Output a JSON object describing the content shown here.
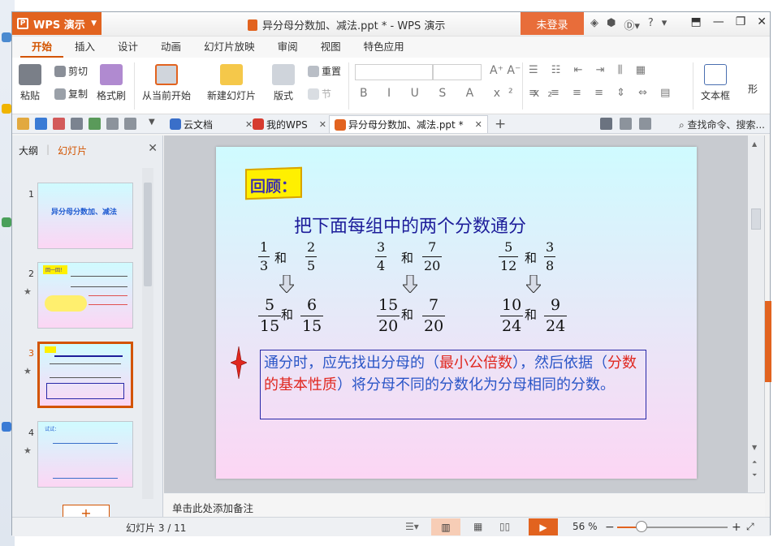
{
  "app": {
    "name": "WPS 演示",
    "doc_title": "异分母分数加、减法.ppt * - WPS 演示",
    "login": "未登录",
    "help": "?"
  },
  "ribbon_tabs": [
    "开始",
    "插入",
    "设计",
    "动画",
    "幻灯片放映",
    "审阅",
    "视图",
    "特色应用"
  ],
  "ribbon": {
    "paste": "粘贴",
    "cut": "剪切",
    "copy": "复制",
    "format_painter": "格式刷",
    "from_current": "从当前开始",
    "new_slide": "新建幻灯片",
    "layout": "版式",
    "reset": "重置",
    "section": "节",
    "textbox": "文本框",
    "shape": "形"
  },
  "doc_tabs": [
    {
      "label": "云文档"
    },
    {
      "label": "我的WPS"
    },
    {
      "label": "异分母分数加、减法.ppt *"
    }
  ],
  "search_command": "查找命令、搜索...",
  "left_panel": {
    "tab_outline": "大纲",
    "tab_slides": "幻灯片",
    "slides": [
      {
        "num": "1",
        "title": "异分母分数加、减法"
      },
      {
        "num": "2",
        "badge": "回一回！"
      },
      {
        "num": "3"
      },
      {
        "num": "4",
        "badge": "试试："
      }
    ]
  },
  "slide": {
    "badge": "回顾：",
    "title": "把下面每组中的两个分数通分",
    "he": "和",
    "groups": [
      {
        "a": [
          "1",
          "3"
        ],
        "b": [
          "2",
          "5"
        ],
        "ra": [
          "5",
          "15"
        ],
        "rb": [
          "6",
          "15"
        ]
      },
      {
        "a": [
          "3",
          "4"
        ],
        "b": [
          "7",
          "20"
        ],
        "ra": [
          "15",
          "20"
        ],
        "rb": [
          "7",
          "20"
        ]
      },
      {
        "a": [
          "5",
          "12"
        ],
        "b": [
          "3",
          "8"
        ],
        "ra": [
          "10",
          "24"
        ],
        "rb": [
          "9",
          "24"
        ]
      }
    ],
    "note_parts": {
      "p1": "通分时，应先找出分母的（",
      "red1": "最小公倍数",
      "p2": "），然后依据（",
      "red2": "分数的基本性质",
      "p3": "）将分母不同的分数化为分母相同的分数。"
    }
  },
  "notes_placeholder": "单击此处添加备注",
  "status": {
    "slide_counter": "幻灯片 3 / 11",
    "zoom": "56 %",
    "zoom_fraction": 0.22
  },
  "colors": {
    "accent": "#e2631f",
    "slide_title": "#1d1d9a",
    "note_text": "#2a55c7",
    "note_red": "#e0271f"
  }
}
